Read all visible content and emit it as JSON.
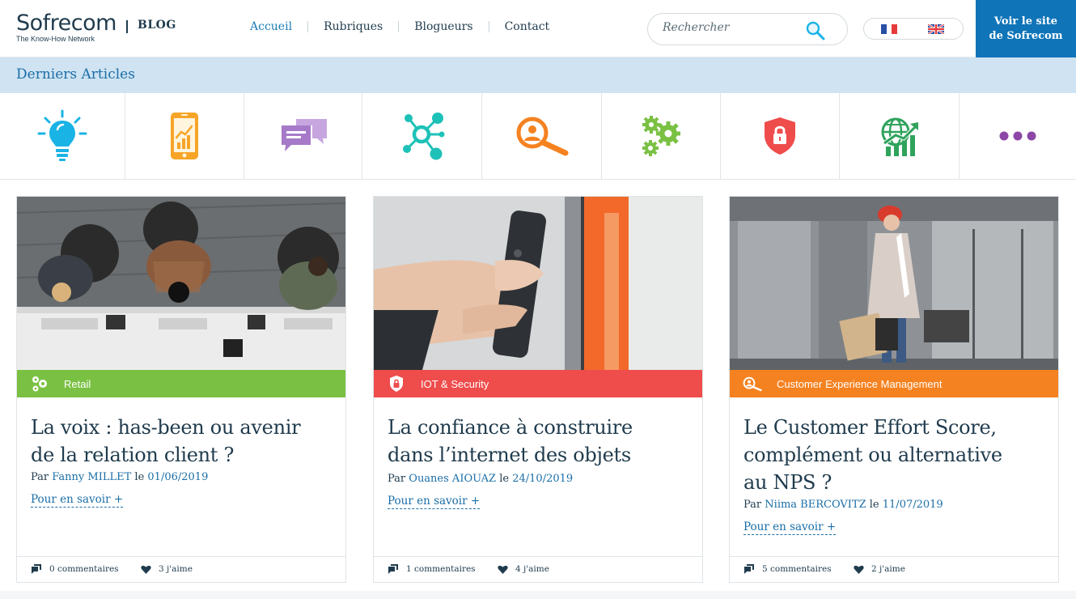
{
  "header": {
    "logo_name": "Sofrecom",
    "logo_tagline": "The Know-How Network",
    "logo_blog": "BLOG",
    "nav": [
      "Accueil",
      "Rubriques",
      "Blogueurs",
      "Contact"
    ],
    "search_placeholder": "Rechercher",
    "search_icon": "search-icon",
    "languages": [
      "fr-flag",
      "uk-flag"
    ],
    "cta_line1": "Voir le site",
    "cta_line2": "de Sofrecom",
    "accent": "#0f74b8"
  },
  "section": {
    "title": "Derniers Articles",
    "bg": "#cfe3f2"
  },
  "categories": [
    {
      "icon": "lightbulb-icon",
      "color": "#1ab3e6"
    },
    {
      "icon": "smartphone-chart-icon",
      "color": "#f7a528"
    },
    {
      "icon": "chat-bubbles-icon",
      "color": "#a77ac9"
    },
    {
      "icon": "network-nodes-icon",
      "color": "#1ec1b7"
    },
    {
      "icon": "search-people-icon",
      "color": "#f58220"
    },
    {
      "icon": "gears-icon",
      "color": "#7ac143"
    },
    {
      "icon": "security-shield-icon",
      "color": "#ef4c4c"
    },
    {
      "icon": "globe-growth-icon",
      "color": "#2fa35c"
    },
    {
      "icon": "more-dots-icon",
      "color": "#8b46a6"
    }
  ],
  "articles": [
    {
      "category": "Retail",
      "category_color": "#7ac143",
      "category_icon": "gears-icon",
      "title_line1": "La voix : has-been ou avenir",
      "title_line2": "de la relation client ?",
      "title_line3": "",
      "by_label": "Par",
      "author": "Fanny MILLET",
      "date_label": "le",
      "date": "01/06/2019",
      "more": "Pour en savoir +",
      "comments": "0 commentaires",
      "likes": "3 j'aime"
    },
    {
      "category": "IOT & Security",
      "category_color": "#ef4c4c",
      "category_icon": "security-shield-icon",
      "title_line1": "La confiance à construire",
      "title_line2": "dans l’internet des objets",
      "title_line3": "",
      "by_label": "Par",
      "author": "Ouanes AIOUAZ",
      "date_label": "le",
      "date": "24/10/2019",
      "more": "Pour en savoir +",
      "comments": "1 commentaires",
      "likes": "4 j'aime"
    },
    {
      "category": "Customer Experience Management",
      "category_color": "#f58220",
      "category_icon": "search-people-icon",
      "title_line1": "Le Customer Effort Score,",
      "title_line2": "complément ou alternative",
      "title_line3": "au NPS ?",
      "by_label": "Par",
      "author": "Niima BERCOVITZ",
      "date_label": "le",
      "date": "11/07/2019",
      "more": "Pour en savoir +",
      "comments": "5 commentaires",
      "likes": "2 j'aime"
    }
  ]
}
